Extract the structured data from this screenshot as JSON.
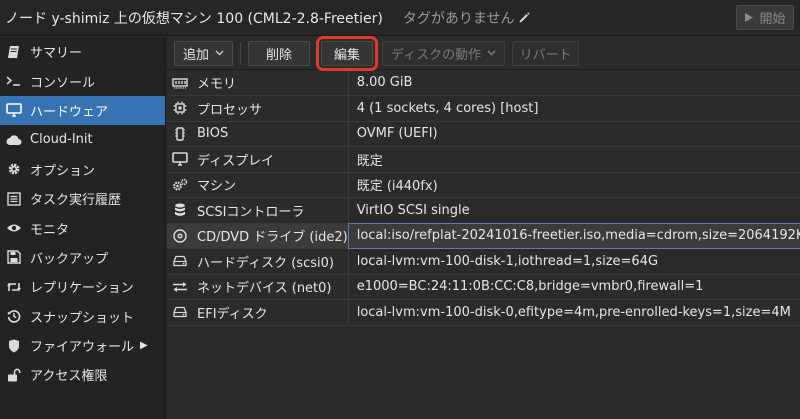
{
  "window": {
    "title": "ノード y-shimiz 上の仮想マシン 100 (CML2-2.8-Freetier)",
    "tags": "タグがありません",
    "start_label": "開始"
  },
  "sidebar": {
    "items": [
      {
        "label": "サマリー",
        "icon": "book-icon"
      },
      {
        "label": "コンソール",
        "icon": "terminal-icon"
      },
      {
        "label": "ハードウェア",
        "icon": "desktop-icon",
        "active": true
      },
      {
        "label": "Cloud-Init",
        "icon": "cloud-icon"
      },
      {
        "label": "オプション",
        "icon": "gear-icon"
      },
      {
        "label": "タスク実行履歴",
        "icon": "list-icon"
      },
      {
        "label": "モニタ",
        "icon": "eye-icon"
      },
      {
        "label": "バックアップ",
        "icon": "floppy-icon"
      },
      {
        "label": "レプリケーション",
        "icon": "retweet-icon"
      },
      {
        "label": "スナップショット",
        "icon": "history-icon"
      },
      {
        "label": "ファイアウォール",
        "icon": "shield-icon"
      },
      {
        "label": "アクセス権限",
        "icon": "unlock-icon"
      }
    ]
  },
  "toolbar": {
    "add_label": "追加",
    "delete_label": "削除",
    "edit_label": "編集",
    "disk_action_label": "ディスクの動作",
    "revert_label": "リバート"
  },
  "hardware": [
    {
      "key": "メモリ",
      "value": "8.00 GiB",
      "icon": "memory-icon"
    },
    {
      "key": "プロセッサ",
      "value": "4 (1 sockets, 4 cores) [host]",
      "icon": "cpu-icon"
    },
    {
      "key": "BIOS",
      "value": "OVMF (UEFI)",
      "icon": "chip-icon"
    },
    {
      "key": "ディスプレイ",
      "value": "既定",
      "icon": "monitor-icon"
    },
    {
      "key": "マシン",
      "value": "既定 (i440fx)",
      "icon": "cogs-icon"
    },
    {
      "key": "SCSIコントローラ",
      "value": "VirtIO SCSI single",
      "icon": "database-icon"
    },
    {
      "key": "CD/DVD ドライブ (ide2)",
      "value": "local:iso/refplat-20241016-freetier.iso,media=cdrom,size=2064192K",
      "icon": "cdrom-icon",
      "selected": true
    },
    {
      "key": "ハードディスク (scsi0)",
      "value": "local-lvm:vm-100-disk-1,iothread=1,size=64G",
      "icon": "hdd-icon"
    },
    {
      "key": "ネットデバイス (net0)",
      "value": "e1000=BC:24:11:0B:CC:C8,bridge=vmbr0,firewall=1",
      "icon": "exchange-icon"
    },
    {
      "key": "EFIディスク",
      "value": "local-lvm:vm-100-disk-0,efitype=4m,pre-enrolled-keys=1,size=4M",
      "icon": "hdd-icon"
    }
  ],
  "colors": {
    "accent": "#3573b3",
    "highlight": "#e03b2a"
  }
}
